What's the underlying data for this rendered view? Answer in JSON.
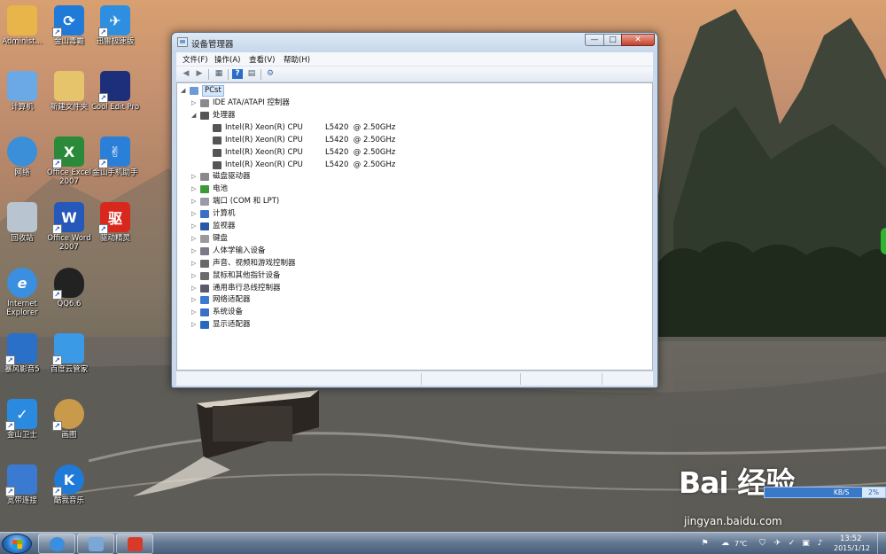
{
  "desktop_icons": [
    {
      "label": "Administ...",
      "glyph": "",
      "color": "#e8b54a"
    },
    {
      "label": "金山毒霸",
      "glyph": "⟳",
      "color": "#1f7ad8"
    },
    {
      "label": "迅雷极速版",
      "glyph": "✈",
      "color": "#2e8fe0"
    },
    {
      "label": "计算机",
      "glyph": "",
      "color": "#6aa8e6"
    },
    {
      "label": "新建文件夹",
      "glyph": "",
      "color": "#e6c46c"
    },
    {
      "label": "Cool Edit Pro",
      "glyph": "",
      "color": "#1d2f7a"
    },
    {
      "label": "网络",
      "glyph": "",
      "color": "#3a8fd8"
    },
    {
      "label": "Office Excel 2007",
      "glyph": "X",
      "color": "#2a8a3a"
    },
    {
      "label": "金山手机助手",
      "glyph": "✌",
      "color": "#2a7fd8"
    },
    {
      "label": "回收站",
      "glyph": "",
      "color": "#b8c4d0"
    },
    {
      "label": "Office Word 2007",
      "glyph": "W",
      "color": "#2558b8"
    },
    {
      "label": "驱动精灵",
      "glyph": "驱",
      "color": "#d8281e"
    },
    {
      "label": "Internet Explorer",
      "glyph": "e",
      "color": "#3a8fe0"
    },
    {
      "label": "QQ6.6",
      "glyph": "",
      "color": "#222222"
    },
    {
      "label": "暴风影音5",
      "glyph": "",
      "color": "#2a6fc8"
    },
    {
      "label": "百度云管家",
      "glyph": "",
      "color": "#3a9ae6"
    },
    {
      "label": "金山卫士",
      "glyph": "✓",
      "color": "#2a8ae0"
    },
    {
      "label": "画图",
      "glyph": "",
      "color": "#c89a4a"
    },
    {
      "label": "宽带连接",
      "glyph": "",
      "color": "#3a7ad0"
    },
    {
      "label": "酷我音乐",
      "glyph": "K",
      "color": "#1f7ad8"
    }
  ],
  "window": {
    "title": "设备管理器",
    "controls": {
      "minimize": "—",
      "maximize": "□",
      "close": "✕"
    },
    "menu": [
      "文件(F)",
      "操作(A)",
      "查看(V)",
      "帮助(H)"
    ],
    "toolbar": [
      {
        "name": "back-icon",
        "glyph": "◀"
      },
      {
        "name": "forward-icon",
        "glyph": "▶"
      },
      {
        "name": "properties-view-icon",
        "glyph": "▦"
      },
      {
        "name": "help-icon",
        "glyph": "?"
      },
      {
        "name": "console-tree-icon",
        "glyph": "▤"
      },
      {
        "name": "scan-hardware-icon",
        "glyph": "⚙"
      }
    ],
    "tree": {
      "root": "PCst",
      "items": [
        {
          "label": "IDE ATA/ATAPI 控制器",
          "expander": "▷",
          "icon_color": "#8a8a8a",
          "level": 1
        },
        {
          "label": "处理器",
          "expander": "◢",
          "icon_color": "#555555",
          "level": 1
        },
        {
          "label": "Intel(R) Xeon(R) CPU",
          "speed": "L5420  @ 2.50GHz",
          "expander": "",
          "icon_color": "#555555",
          "level": 2
        },
        {
          "label": "Intel(R) Xeon(R) CPU",
          "speed": "L5420  @ 2.50GHz",
          "expander": "",
          "icon_color": "#555555",
          "level": 2
        },
        {
          "label": "Intel(R) Xeon(R) CPU",
          "speed": "L5420  @ 2.50GHz",
          "expander": "",
          "icon_color": "#555555",
          "level": 2
        },
        {
          "label": "Intel(R) Xeon(R) CPU",
          "speed": "L5420  @ 2.50GHz",
          "expander": "",
          "icon_color": "#555555",
          "level": 2
        },
        {
          "label": "磁盘驱动器",
          "expander": "▷",
          "icon_color": "#8a8a8a",
          "level": 1
        },
        {
          "label": "电池",
          "expander": "▷",
          "icon_color": "#3a9a3a",
          "level": 1
        },
        {
          "label": "端口 (COM 和 LPT)",
          "expander": "▷",
          "icon_color": "#9a9aa8",
          "level": 1
        },
        {
          "label": "计算机",
          "expander": "▷",
          "icon_color": "#3a6fc8",
          "level": 1
        },
        {
          "label": "监视器",
          "expander": "▷",
          "icon_color": "#2a58a8",
          "level": 1
        },
        {
          "label": "键盘",
          "expander": "▷",
          "icon_color": "#9a9a9a",
          "level": 1
        },
        {
          "label": "人体学输入设备",
          "expander": "▷",
          "icon_color": "#7a7a8a",
          "level": 1
        },
        {
          "label": "声音、视频和游戏控制器",
          "expander": "▷",
          "icon_color": "#6a6a6a",
          "level": 1
        },
        {
          "label": "鼠标和其他指针设备",
          "expander": "▷",
          "icon_color": "#6a6a6a",
          "level": 1
        },
        {
          "label": "通用串行总线控制器",
          "expander": "▷",
          "icon_color": "#5a5a6a",
          "level": 1
        },
        {
          "label": "网络适配器",
          "expander": "▷",
          "icon_color": "#3a7ad0",
          "level": 1
        },
        {
          "label": "系统设备",
          "expander": "▷",
          "icon_color": "#3a6fc8",
          "level": 1
        },
        {
          "label": "显示适配器",
          "expander": "▷",
          "icon_color": "#2a68c0",
          "level": 1
        }
      ]
    }
  },
  "taskbar": {
    "pinned": [
      {
        "name": "taskbar-ie",
        "color": "#3a8fe0"
      },
      {
        "name": "taskbar-device-manager",
        "color": "#7aa6d8"
      },
      {
        "name": "taskbar-toolbox",
        "color": "#d83a2a"
      }
    ],
    "tray": {
      "temperature": "7℃"
    },
    "clock": {
      "time": "13:52",
      "date": "2015/1/12"
    }
  },
  "overlay": {
    "net_speed": "KB/S",
    "net_percent": "2%",
    "watermark_logo": "Bai  经验",
    "watermark_url": "jingyan.baidu.com"
  }
}
